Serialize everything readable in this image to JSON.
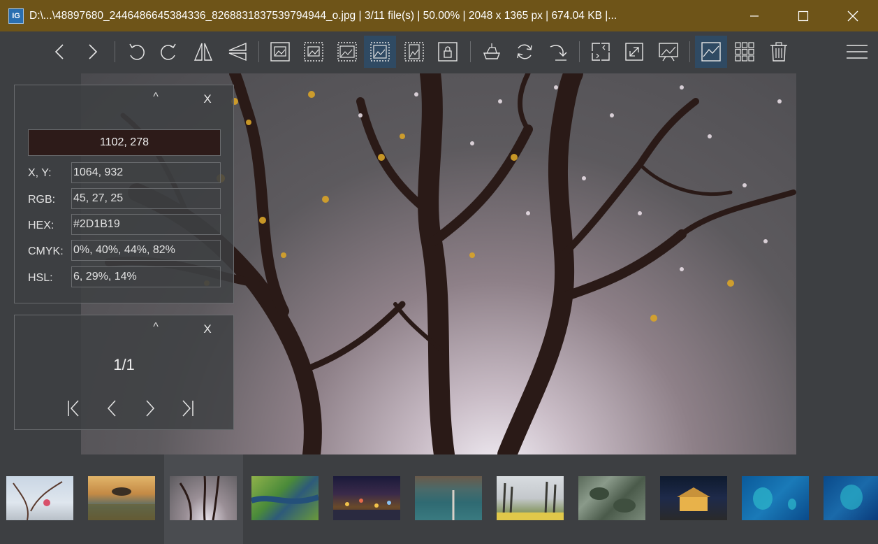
{
  "window": {
    "app_icon_text": "IG",
    "title": "D:\\...\\48897680_2446486645384336_8268831837539794944_o.jpg  |  3/11 file(s)  |  50.00%  |  2048 x 1365 px  |  674.04 KB  |...",
    "minimize_icon": "minimize-icon",
    "maximize_icon": "maximize-icon",
    "close_icon": "close-icon"
  },
  "toolbar": {
    "icons": [
      "prev-image-icon",
      "next-image-icon",
      "rotate-left-icon",
      "rotate-right-icon",
      "flip-horizontal-icon",
      "flip-vertical-icon",
      "auto-zoom-icon",
      "lock-zoom-icon",
      "scale-to-width-icon",
      "scale-to-fit-icon",
      "scale-to-height-icon",
      "lock-zoom-ratio-icon",
      "open-with-icon",
      "refresh-icon",
      "goto-icon",
      "crop-icon",
      "fullscreen-icon",
      "slideshow-icon",
      "thumbnail-bar-icon",
      "checkerboard-icon",
      "delete-icon",
      "menu-icon"
    ],
    "active": [
      "scale-to-fit-icon",
      "thumbnail-bar-icon"
    ]
  },
  "color_picker": {
    "collapse_label": "^",
    "close_label": "X",
    "swatch_value": "1102, 278",
    "swatch_color": "#2D1B19",
    "rows": [
      {
        "label": "X, Y:",
        "value": "1064, 932"
      },
      {
        "label": "RGB:",
        "value": "45, 27, 25"
      },
      {
        "label": "HEX:",
        "value": "#2D1B19"
      },
      {
        "label": "CMYK:",
        "value": "0%, 40%, 44%, 82%"
      },
      {
        "label": "HSL:",
        "value": "6, 29%, 14%"
      }
    ]
  },
  "page_nav": {
    "collapse_label": "^",
    "close_label": "X",
    "page_count": "1/1"
  },
  "thumbnails": {
    "count": 11,
    "selected_index": 2
  },
  "colors": {
    "titlebar": "#6e5418",
    "background": "#3d3f42",
    "active_button": "#2f4a63"
  }
}
